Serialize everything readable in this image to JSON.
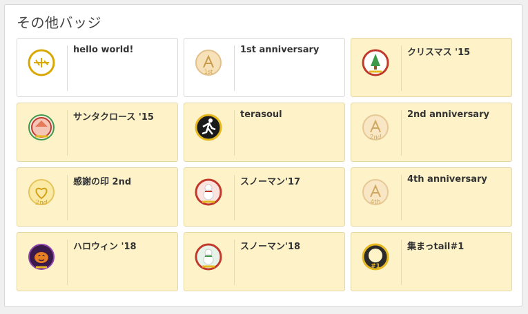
{
  "section_title": "その他バッジ",
  "badges": [
    {
      "label": "hello world!",
      "icon": "hello-world-badge-icon",
      "owned": false
    },
    {
      "label": "1st anniversary",
      "icon": "first-anniversary-badge-icon",
      "owned": false
    },
    {
      "label": "クリスマス '15",
      "icon": "christmas-tree-badge-icon",
      "owned": true
    },
    {
      "label": "サンタクロース '15",
      "icon": "santa-claus-badge-icon",
      "owned": true
    },
    {
      "label": "terasoul",
      "icon": "terasoul-runner-badge-icon",
      "owned": true
    },
    {
      "label": "2nd anniversary",
      "icon": "second-anniversary-badge-icon",
      "owned": true
    },
    {
      "label": "感謝の印 2nd",
      "icon": "thanks-heart-badge-icon",
      "owned": true
    },
    {
      "label": "スノーマン'17",
      "icon": "snowman-17-badge-icon",
      "owned": true
    },
    {
      "label": "4th anniversary",
      "icon": "fourth-anniversary-badge-icon",
      "owned": true
    },
    {
      "label": "ハロウィン '18",
      "icon": "halloween-pumpkin-badge-icon",
      "owned": true
    },
    {
      "label": "スノーマン'18",
      "icon": "snowman-18-badge-icon",
      "owned": true
    },
    {
      "label": "集まっtail#1",
      "icon": "atsumattail-ring-badge-icon",
      "owned": true
    }
  ],
  "colors": {
    "owned_background": "#fdf2c8",
    "unowned_background": "#ffffff",
    "gold": "#d4a017",
    "red": "#c0392b",
    "green": "#3e9a4a"
  }
}
